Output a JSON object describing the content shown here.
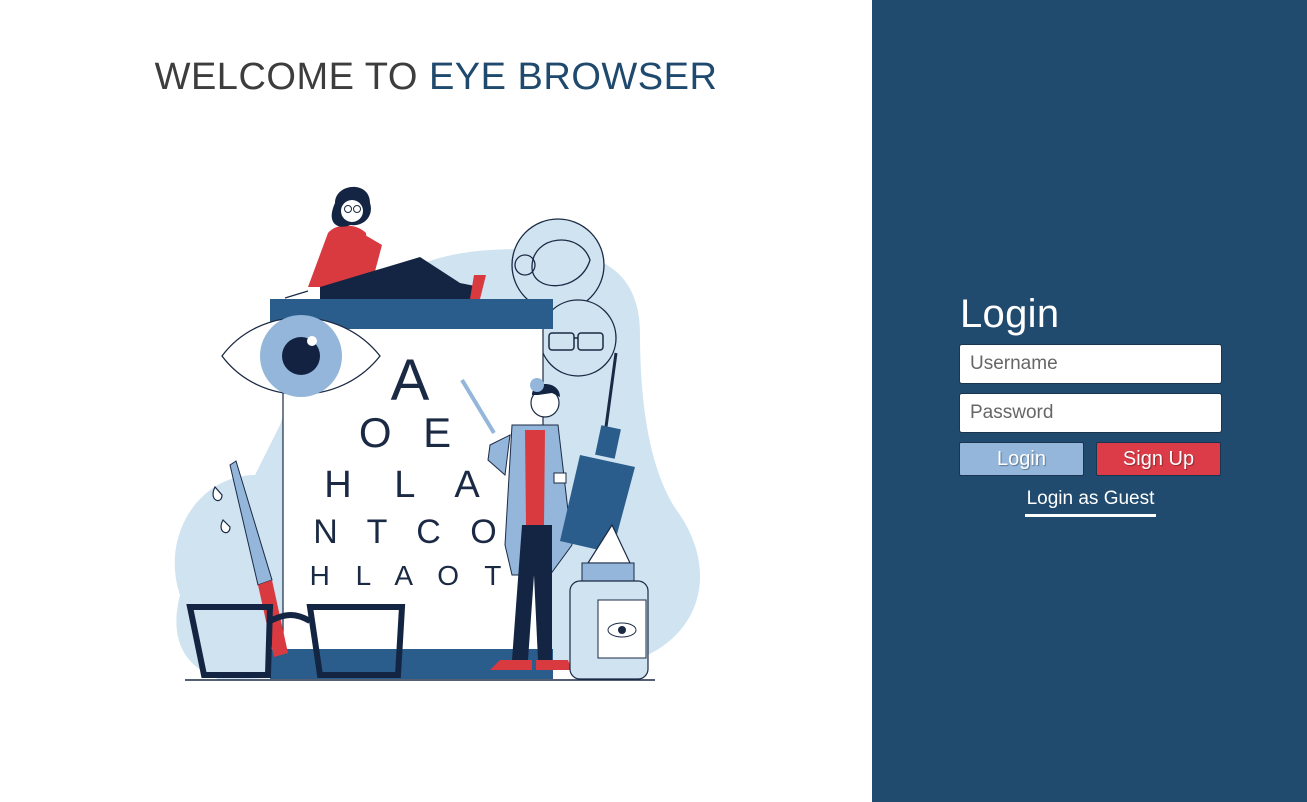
{
  "welcome": {
    "prefix": "WELCOME TO ",
    "brand": "EYE BROWSER"
  },
  "eye_chart": {
    "rows": [
      "A",
      "O E",
      "H L A",
      "N T C O",
      "H L A O T"
    ]
  },
  "login": {
    "title": "Login",
    "username_placeholder": "Username",
    "password_placeholder": "Password",
    "login_button": "Login",
    "signup_button": "Sign Up",
    "guest_link": "Login as Guest"
  },
  "colors": {
    "sidebar_bg": "#204a6e",
    "brand_text": "#1f4a6e",
    "login_button": "#93b6da",
    "signup_button": "#db3c48",
    "accent_red": "#d83a3f",
    "light_blue_blob": "#cfe3f1"
  }
}
